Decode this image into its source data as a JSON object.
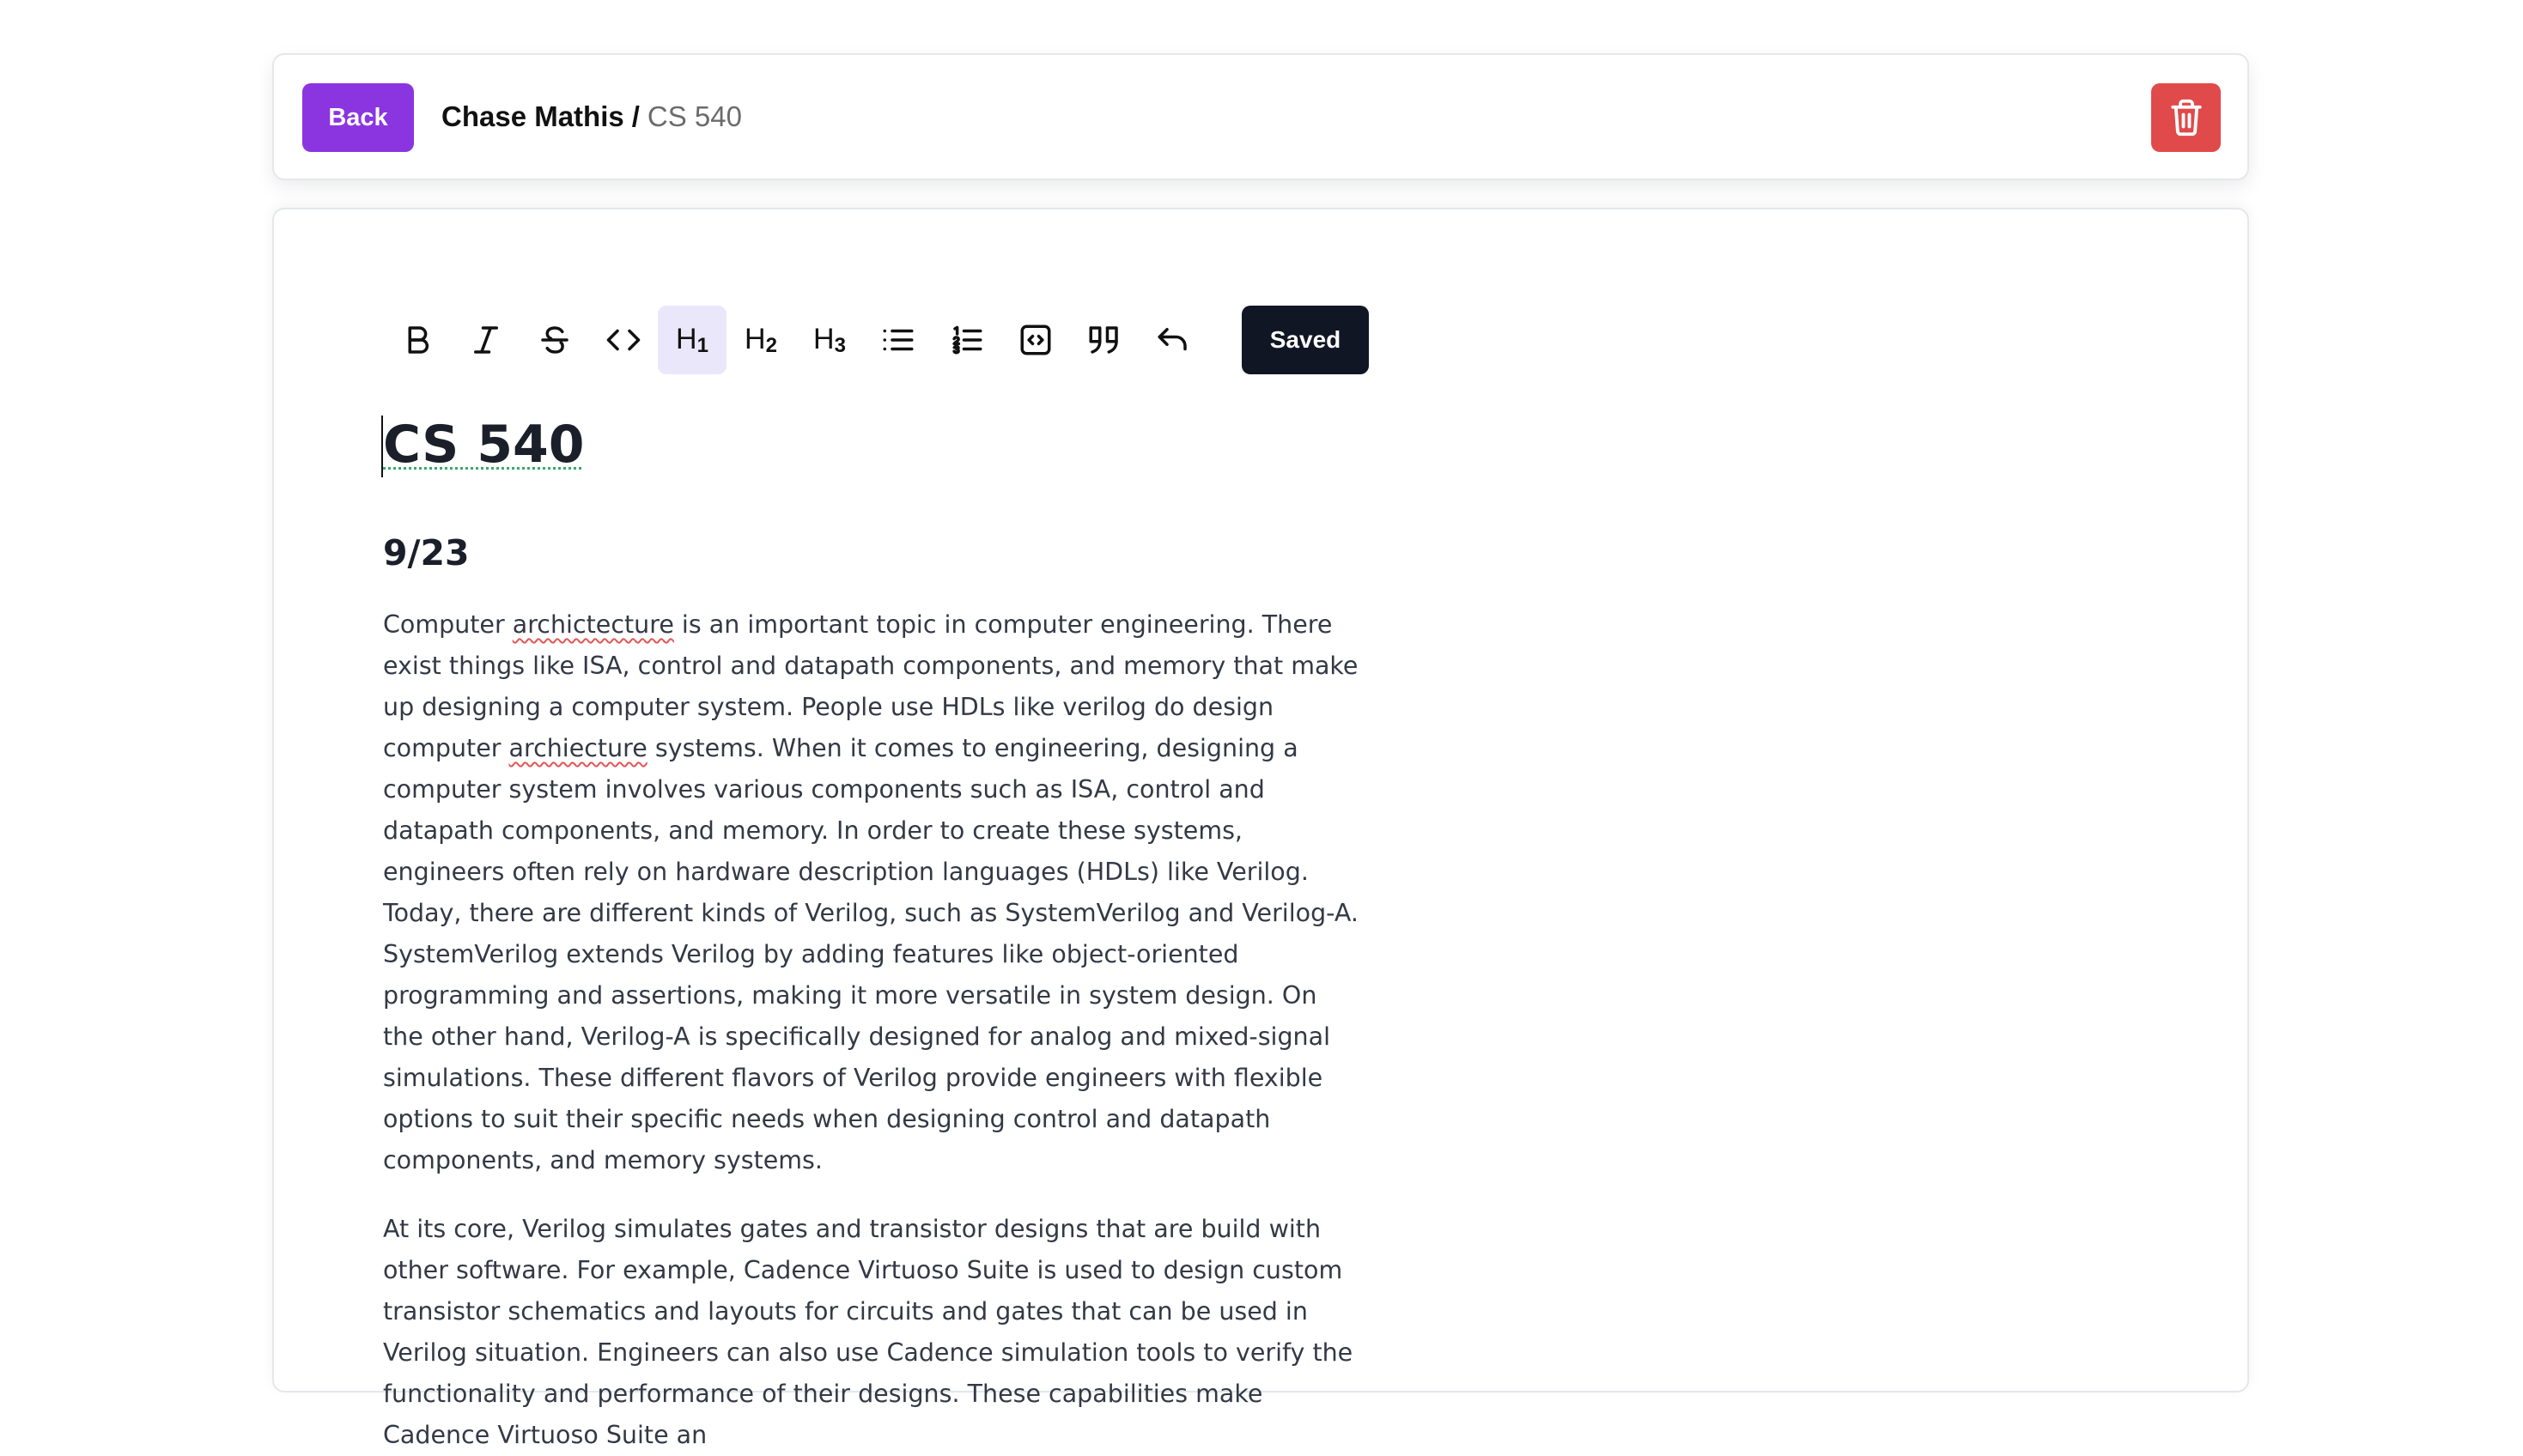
{
  "header": {
    "back_label": "Back",
    "user_name": "Chase Mathis",
    "separator": "/",
    "note_name": "CS 540",
    "delete_color": "#e04a4a",
    "back_color": "#8b35e0"
  },
  "toolbar": {
    "tools": [
      {
        "name": "bold",
        "icon": "bold-icon",
        "active": false
      },
      {
        "name": "italic",
        "icon": "italic-icon",
        "active": false
      },
      {
        "name": "strikethrough",
        "icon": "strikethrough-icon",
        "active": false
      },
      {
        "name": "code",
        "icon": "code-icon",
        "active": false
      },
      {
        "name": "heading-1",
        "label": "H",
        "sub": "1",
        "active": true
      },
      {
        "name": "heading-2",
        "label": "H",
        "sub": "2",
        "active": false
      },
      {
        "name": "heading-3",
        "label": "H",
        "sub": "3",
        "active": false
      },
      {
        "name": "bullet-list",
        "icon": "bullet-list-icon",
        "active": false
      },
      {
        "name": "ordered-list",
        "icon": "ordered-list-icon",
        "active": false
      },
      {
        "name": "code-block",
        "icon": "code-block-icon",
        "active": false
      },
      {
        "name": "blockquote",
        "icon": "quote-icon",
        "active": false
      },
      {
        "name": "undo",
        "icon": "undo-icon",
        "active": false
      }
    ],
    "saved_label": "Saved"
  },
  "document": {
    "title": "CS 540",
    "subheading": "9/23",
    "paragraph1": {
      "p1a": "Computer ",
      "p1b": "archictecture",
      "p1c": " is an important topic in computer engineering. There exist things like ISA, control and datapath components, and memory that make up designing a computer system. People use HDLs like verilog do design computer ",
      "p1d": "archiecture",
      "p1e": " systems. When it comes to engineering, designing a computer system involves various components such as ISA, control and datapath components, and memory. In order to create these systems, engineers often rely on hardware description languages (HDLs) like Verilog. Today, there are different kinds of Verilog, such as SystemVerilog and Verilog-A. SystemVerilog extends Verilog by adding features like object-oriented programming and assertions, making it more versatile in system design. On the other hand, Verilog-A is specifically designed for analog and mixed-signal simulations. These different flavors of Verilog provide engineers with flexible options to suit their specific needs when designing control and datapath components, and memory systems."
    },
    "paragraph2": "At its core, Verilog simulates gates and transistor designs that are build with other software. For example, Cadence Virtuoso Suite is used to design custom transistor schematics and layouts for circuits and gates that can be used in Verilog situation. Engineers can also use Cadence simulation tools to verify the functionality and performance of their designs. These capabilities make Cadence Virtuoso Suite an"
  }
}
